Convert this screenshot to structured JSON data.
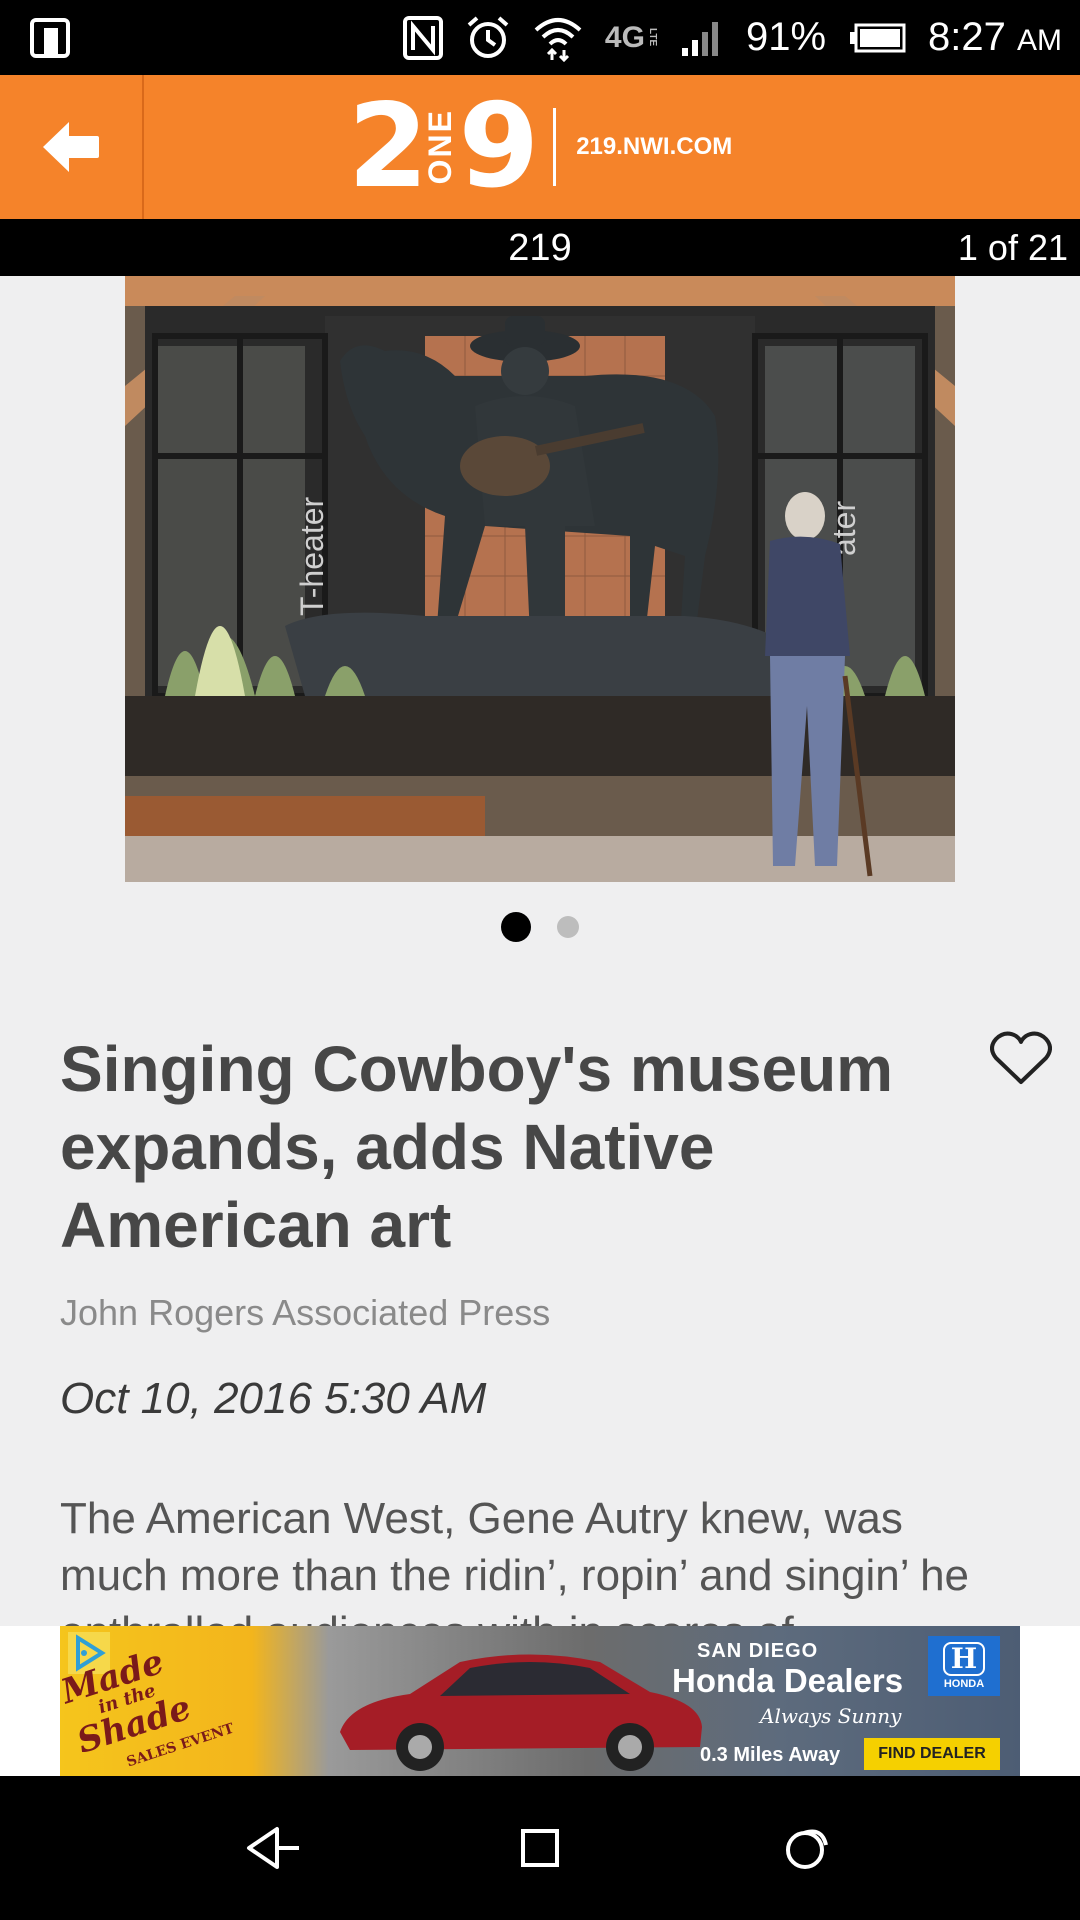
{
  "status_bar": {
    "battery": "91%",
    "time": "8:27",
    "ampm": "AM",
    "network": "4G",
    "network_sub": "LTE"
  },
  "app_bar": {
    "logo_digit_left": "2",
    "logo_word": "ONE",
    "logo_digit_right": "9",
    "logo_url": "219.NWI.COM",
    "accent": "#f5832a"
  },
  "sub_bar": {
    "title": "219",
    "counter": "1 of 21"
  },
  "gallery": {
    "sign_left": "T-heater",
    "sign_right": "ater",
    "active_index": 0,
    "count": 2
  },
  "article": {
    "headline": "Singing Cowboy's museum expands, adds Native American art",
    "byline": "John Rogers Associated Press",
    "date": "Oct 10, 2016 5:30 AM",
    "body": "The American West, Gene Autry knew, was much more than the ridin’, ropin’ and singin’ he enthralled audiences with in scores of"
  },
  "ad": {
    "promo_line1": "Made",
    "promo_line2": "in the",
    "promo_line3": "Shade",
    "promo_sub": "SALES EVENT",
    "city": "SAN DIEGO",
    "brand": "Honda Dealers",
    "tagline": "Always Sunny",
    "logo_text": "HONDA",
    "distance": "0.3 Miles Away",
    "cta": "FIND DEALER"
  }
}
